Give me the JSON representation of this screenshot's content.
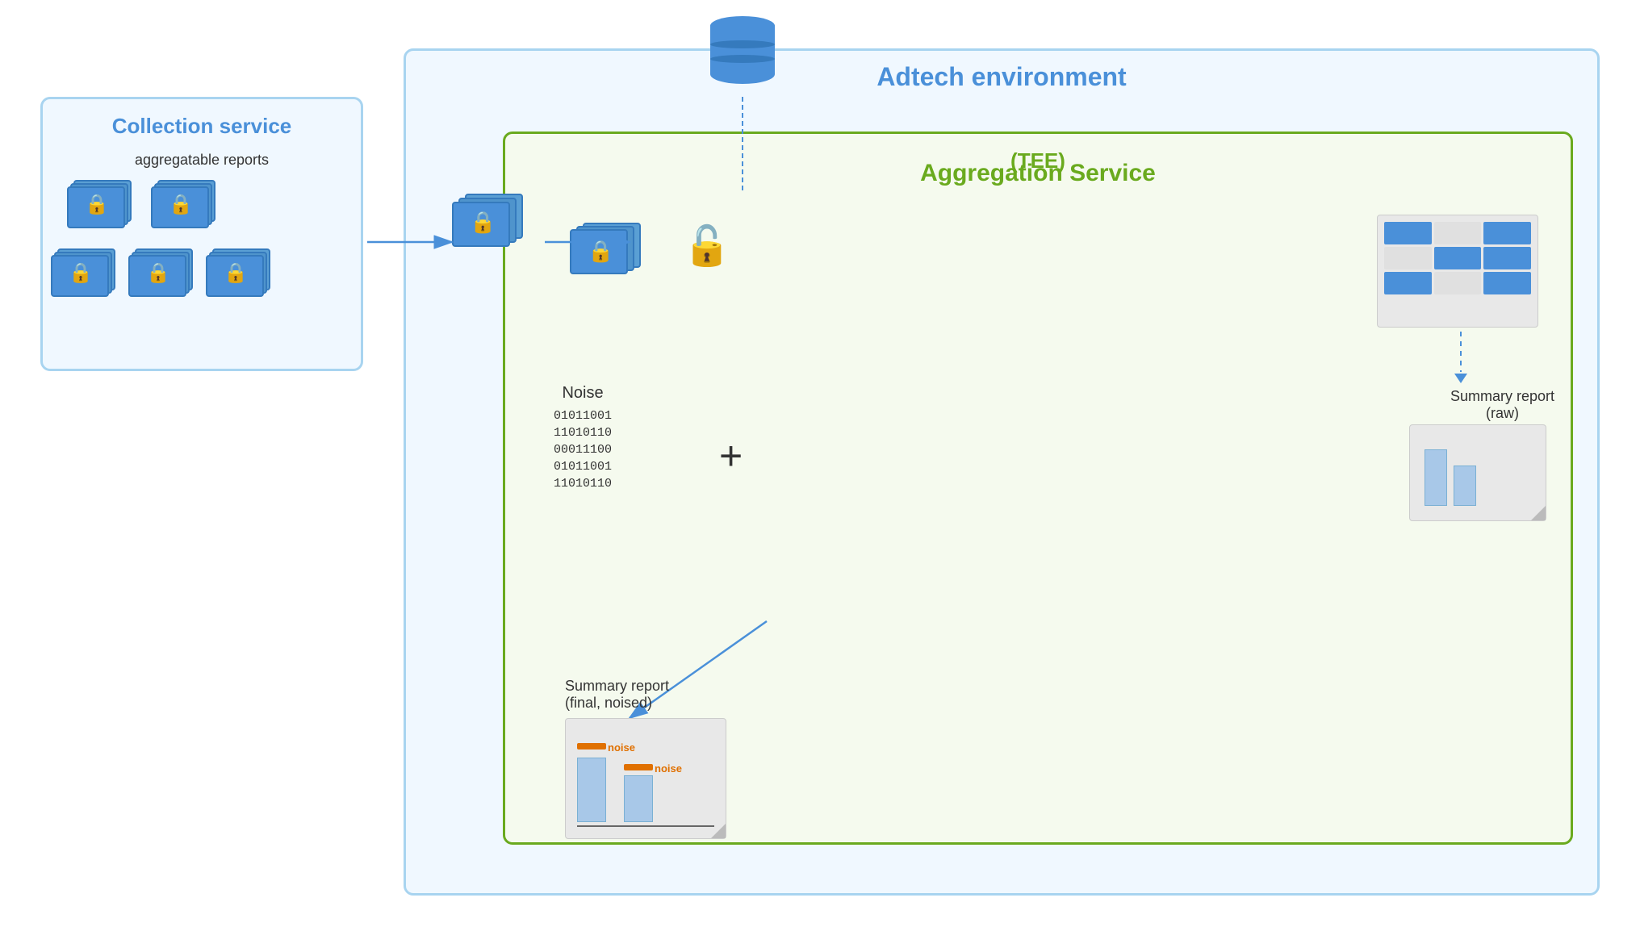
{
  "adtech": {
    "label": "Adtech environment"
  },
  "collection": {
    "title": "Collection service",
    "subtitle": "aggregatable reports"
  },
  "aggregation": {
    "title": "Aggregation Service",
    "subtitle": "(TEE)"
  },
  "noise": {
    "label": "Noise",
    "binary": [
      "01011001",
      "11010110",
      "00011100",
      "01011001",
      "11010110"
    ]
  },
  "summary_raw": {
    "label": "Summary report",
    "sublabel": "(raw)"
  },
  "summary_final": {
    "label": "Summary report",
    "sublabel": "(final, noised)"
  },
  "noise_bar1": "noise",
  "noise_bar2": "noise"
}
